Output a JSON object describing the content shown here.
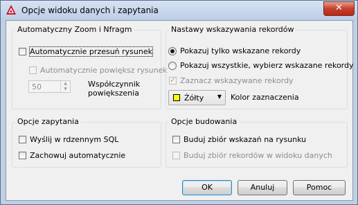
{
  "window": {
    "title": "Opcje widoku danych i zapytania",
    "close_label": "✕"
  },
  "zoom_group": {
    "label": "Automatyczny Zoom i Nfragm",
    "auto_pan": {
      "label": "Automatycznie przesuń rysunek",
      "checked": false
    },
    "auto_zoom": {
      "label": "Automatycznie powiększ rysunek",
      "checked": false,
      "enabled": false
    },
    "zoom_factor": {
      "value": "50",
      "label_line1": "Współczynnik",
      "label_line2": "powiększenia"
    }
  },
  "record_group": {
    "label": "Nastawy wskazywania rekordów",
    "show_only": "Pokazuj tylko wskazane rekordy",
    "show_all": "Pokazuj wszystkie, wybierz wskazane rekordy",
    "selected_option": "show_only",
    "mark_selected": {
      "label": "Zaznacz wskazywane rekordy",
      "checked": true,
      "enabled": false
    },
    "color": {
      "value": "Żółty",
      "swatch": "#ffff00",
      "label": "Kolor zaznaczenia"
    }
  },
  "query_group": {
    "label": "Opcje zapytania",
    "send_sql": {
      "label": "Wyślij w rdzennym SQL",
      "checked": false
    },
    "save_auto": {
      "label": "Zachowuj automatycznie",
      "checked": false
    }
  },
  "build_group": {
    "label": "Opcje budowania",
    "build_drawing": {
      "label": "Buduj zbiór wskazań na rysunku",
      "checked": false
    },
    "build_data_view": {
      "label": "Buduj zbiór rekordów w widoku danych",
      "checked": false,
      "enabled": false
    }
  },
  "buttons": {
    "ok": "OK",
    "cancel": "Anuluj",
    "help": "Pomoc"
  },
  "colors": {
    "title_bar": "#bccde6",
    "close_button": "#c7402a",
    "dialog_bg": "#f0f0f0",
    "accent": "#3c7fb1"
  }
}
